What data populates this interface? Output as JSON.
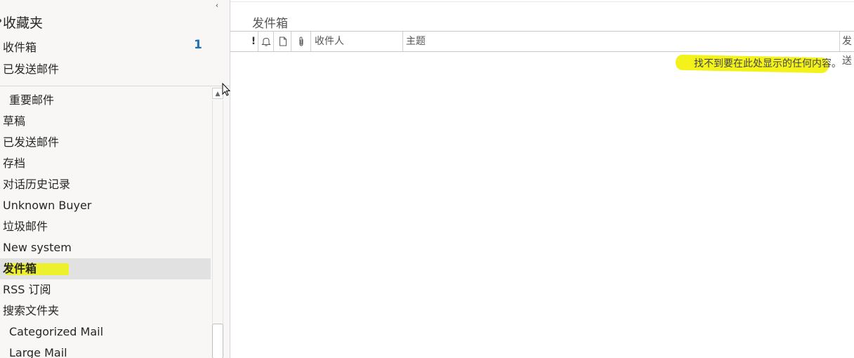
{
  "sidebar": {
    "collapse_glyph": "‹",
    "favorites": {
      "title": "收藏夹",
      "items": [
        {
          "label": "收件箱",
          "count": "1"
        },
        {
          "label": "已发送邮件"
        }
      ]
    },
    "folders": [
      {
        "label": "重要邮件",
        "indent": true
      },
      {
        "label": "草稿"
      },
      {
        "label": "已发送邮件"
      },
      {
        "label": "存档"
      },
      {
        "label": "对话历史记录"
      },
      {
        "label": "Unknown Buyer"
      },
      {
        "label": "垃圾邮件"
      },
      {
        "label": "New system"
      },
      {
        "label": "发件箱",
        "selected": true
      },
      {
        "label": "RSS 订阅"
      },
      {
        "label": "搜索文件夹"
      },
      {
        "label": "Categorized Mail",
        "indent": true
      },
      {
        "label": "Large Mail",
        "indent": true
      }
    ]
  },
  "main": {
    "folder_title": "发件箱",
    "columns": {
      "importance": "!",
      "reminder_icon": "bell-icon",
      "item_icon": "document-icon",
      "attachment_icon": "paperclip-icon",
      "to": "收件人",
      "subject": "主题",
      "sent": "发送"
    },
    "empty_message": "找不到要在此处显示的任何内容。"
  },
  "colors": {
    "highlight": "#eef21a",
    "count": "#1f6fb5",
    "selected_bg": "#e1e1e1"
  }
}
